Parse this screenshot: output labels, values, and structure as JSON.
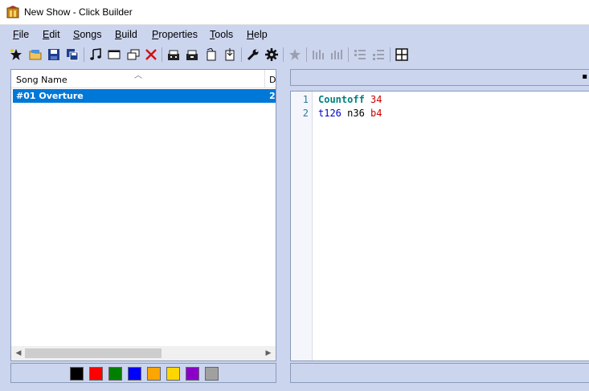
{
  "window": {
    "title": "New Show - Click Builder"
  },
  "menu": [
    {
      "ul": "F",
      "rest": "ile"
    },
    {
      "ul": "E",
      "rest": "dit"
    },
    {
      "ul": "S",
      "rest": "ongs"
    },
    {
      "ul": "B",
      "rest": "uild"
    },
    {
      "ul": "P",
      "rest": "roperties"
    },
    {
      "ul": "T",
      "rest": "ools"
    },
    {
      "ul": "H",
      "rest": "elp"
    }
  ],
  "toolbar_icons": [
    "new-star-icon",
    "open-folder-icon",
    "save-icon",
    "save-all-icon",
    "music-notes-icon",
    "window-icon",
    "copy-window-icon",
    "delete-x-icon",
    "build-icon",
    "build-all-icon",
    "export-icon",
    "import-icon",
    "wrench-icon",
    "gear-icon",
    "favorite-icon",
    "bars-icon",
    "bars-alt-icon",
    "list-icon",
    "list-alt-icon",
    "grid-icon"
  ],
  "song_list": {
    "columns": [
      "Song Name",
      "D"
    ],
    "rows": [
      {
        "name": "#01 Overture",
        "d": "2",
        "selected": true
      }
    ]
  },
  "swatches": [
    "#000000",
    "#ff0000",
    "#008000",
    "#0000ff",
    "#ffa500",
    "#ffd700",
    "#8b00c8",
    "#a0a0a0"
  ],
  "editor": {
    "lines": [
      {
        "num": "1",
        "tokens": [
          {
            "t": "Countoff",
            "c": "kw"
          },
          {
            "t": " ",
            "c": "plain"
          },
          {
            "t": "34",
            "c": "num"
          }
        ]
      },
      {
        "num": "2",
        "tokens": [
          {
            "t": "t126",
            "c": "tempo"
          },
          {
            "t": " n36 ",
            "c": "plain"
          },
          {
            "t": "b4",
            "c": "num"
          }
        ]
      }
    ]
  }
}
